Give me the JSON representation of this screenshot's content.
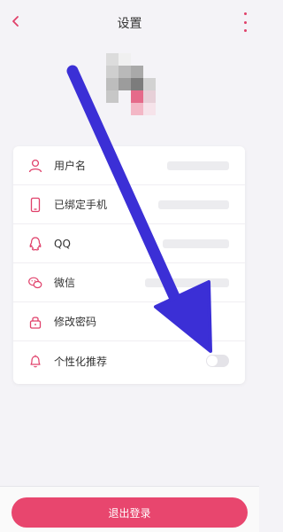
{
  "header": {
    "title": "设置",
    "back_icon": "chevron-left-icon",
    "more_icon": "more-vertical-icon"
  },
  "settings": [
    {
      "label": "用户名",
      "icon": "user-icon"
    },
    {
      "label": "已绑定手机",
      "icon": "phone-icon"
    },
    {
      "label": "QQ",
      "icon": "qq-icon"
    },
    {
      "label": "微信",
      "icon": "wechat-icon"
    },
    {
      "label": "修改密码",
      "icon": "lock-icon"
    },
    {
      "label": "个性化推荐",
      "icon": "bell-icon",
      "toggle_on": false
    }
  ],
  "footer": {
    "logout_label": "退出登录"
  },
  "colors": {
    "accent": "#e8466e",
    "icon": "#e0406a",
    "arrow": "#3b2fd6"
  }
}
